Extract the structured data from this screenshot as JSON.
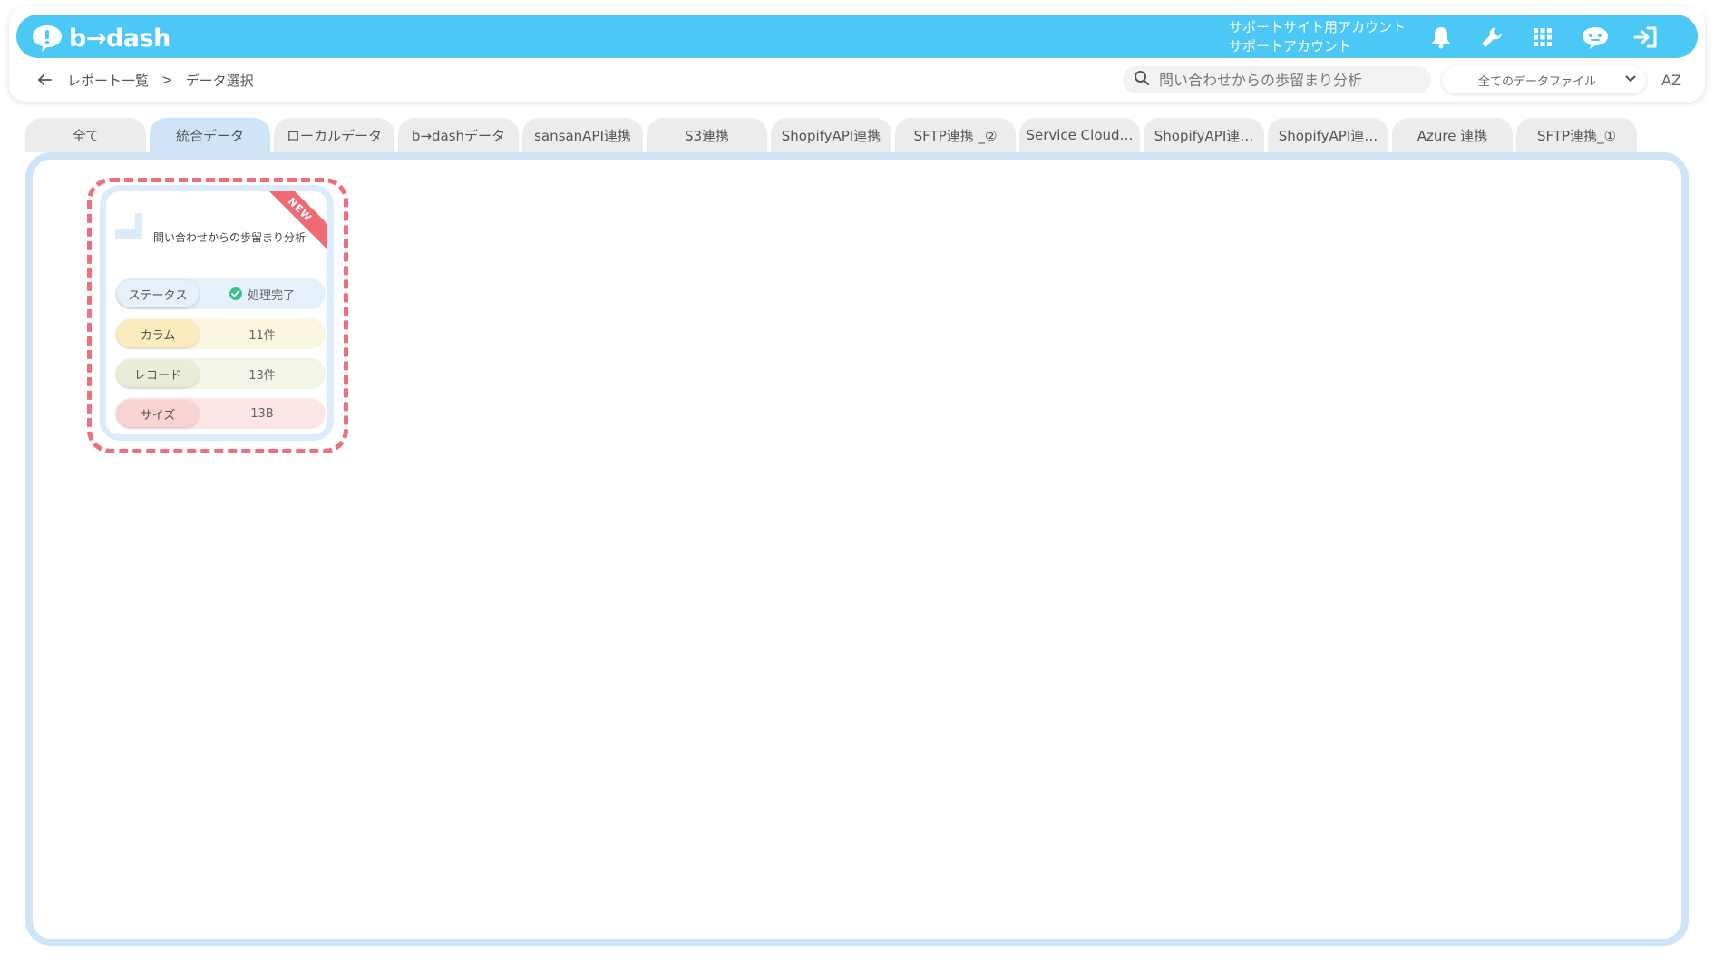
{
  "header": {
    "logo_text": "b→dash",
    "account_line1": "サポートサイト用アカウント",
    "account_line2": "サポートアカウント",
    "icons": [
      "bell-icon",
      "wrench-icon",
      "grid-icon",
      "chat-bot-icon",
      "logout-icon"
    ],
    "accent_color": "#4bc8f5"
  },
  "breadcrumb": {
    "back": "←",
    "items": [
      "レポート一覧",
      "データ選択"
    ],
    "separator": ">"
  },
  "search": {
    "value": "",
    "placeholder": "問い合わせからの歩留まり分析"
  },
  "filter": {
    "selected": "全てのデータファイル"
  },
  "sort_label": "AZ",
  "tabs": [
    {
      "label": "全て"
    },
    {
      "label": "統合データ"
    },
    {
      "label": "ローカルデータ"
    },
    {
      "label": "b→dashデータ"
    },
    {
      "label": "sansanAPI連携"
    },
    {
      "label": "S3連携"
    },
    {
      "label": "ShopifyAPI連携"
    },
    {
      "label": "SFTP連携 _②"
    },
    {
      "label": "Service Cloud…"
    },
    {
      "label": "ShopifyAPI連…"
    },
    {
      "label": "ShopifyAPI連…"
    },
    {
      "label": "Azure 連携"
    },
    {
      "label": "SFTP連携_①"
    }
  ],
  "active_tab": 1,
  "card": {
    "badge": "NEW",
    "title": "問い合わせからの歩留まり分析",
    "rows": [
      {
        "key": "ステータス",
        "value": "処理完了"
      },
      {
        "key": "カラム",
        "value": "11件"
      },
      {
        "key": "レコード",
        "value": "13件"
      },
      {
        "key": "サイズ",
        "value": "13B"
      }
    ]
  }
}
